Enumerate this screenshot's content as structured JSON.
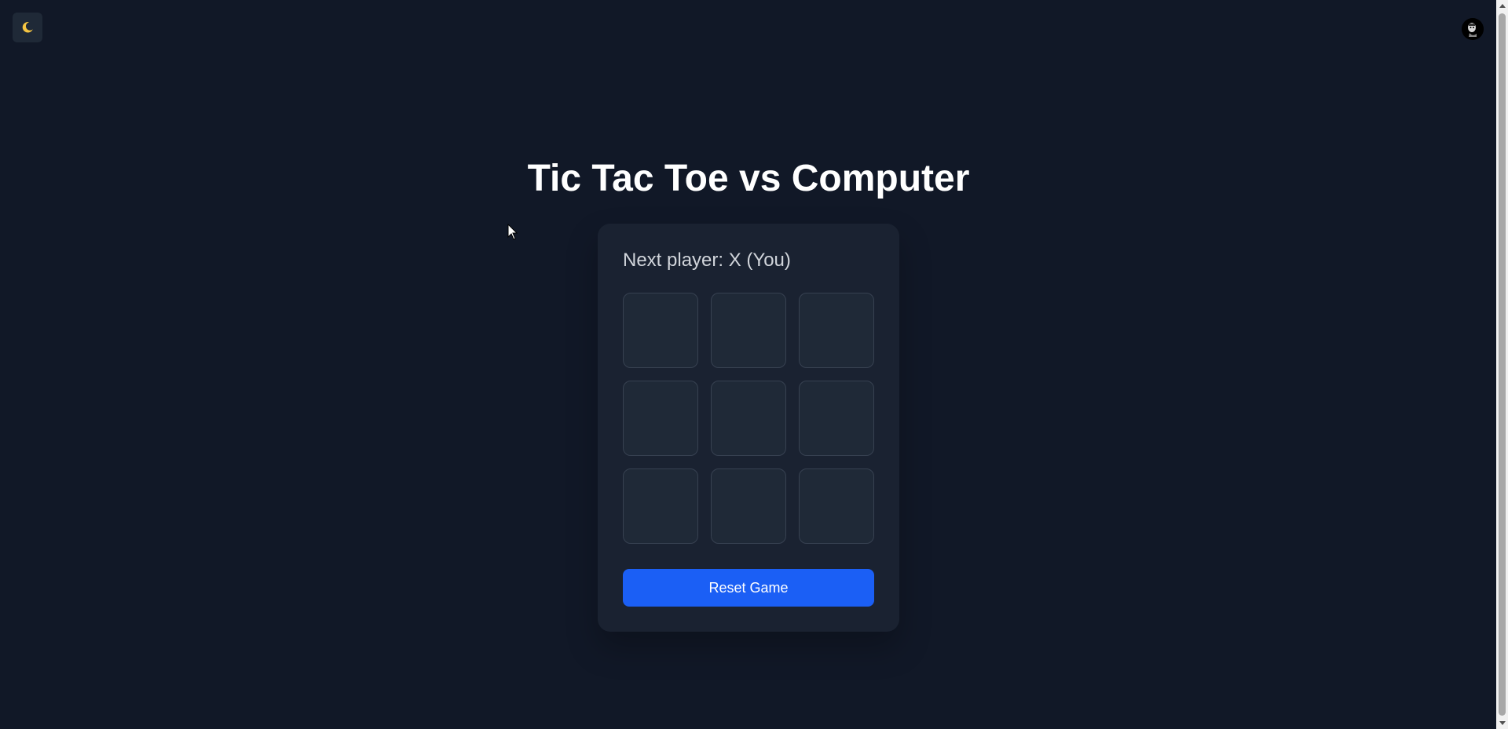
{
  "header": {
    "theme_toggle_icon": "moon-icon",
    "avatar_icon": "user-avatar-icon"
  },
  "main": {
    "title": "Tic Tac Toe vs Computer"
  },
  "game": {
    "status": "Next player: X (You)",
    "cells": [
      "",
      "",
      "",
      "",
      "",
      "",
      "",
      "",
      ""
    ],
    "reset_label": "Reset Game"
  },
  "colors": {
    "background": "#111827",
    "card": "#1a2231",
    "cell": "#1f2937",
    "accent": "#1b5ff5"
  }
}
